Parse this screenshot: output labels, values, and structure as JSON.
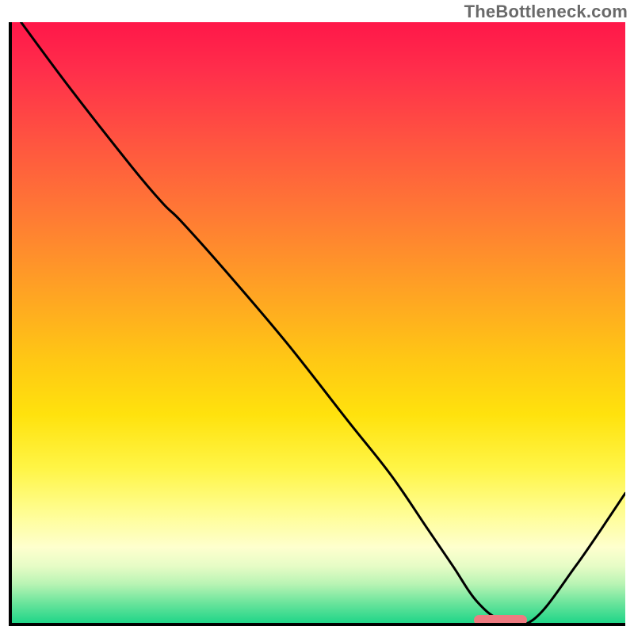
{
  "watermark": "TheBottleneck.com",
  "chart_data": {
    "type": "line",
    "title": "",
    "xlabel": "",
    "ylabel": "",
    "xlim": [
      0,
      100
    ],
    "ylim": [
      0,
      100
    ],
    "series": [
      {
        "name": "bottleneck-curve",
        "x": [
          2,
          10,
          20,
          25,
          28,
          35,
          45,
          55,
          62,
          68,
          72,
          76,
          80,
          85,
          92,
          100
        ],
        "values": [
          100,
          89,
          76,
          70,
          67,
          59,
          47,
          34,
          25,
          16,
          10,
          4,
          1,
          1,
          10,
          22
        ]
      }
    ],
    "marker": {
      "name": "optimal-zone",
      "x_start": 75.5,
      "x_end": 84,
      "y": 1
    },
    "background": "rainbow-vertical"
  }
}
